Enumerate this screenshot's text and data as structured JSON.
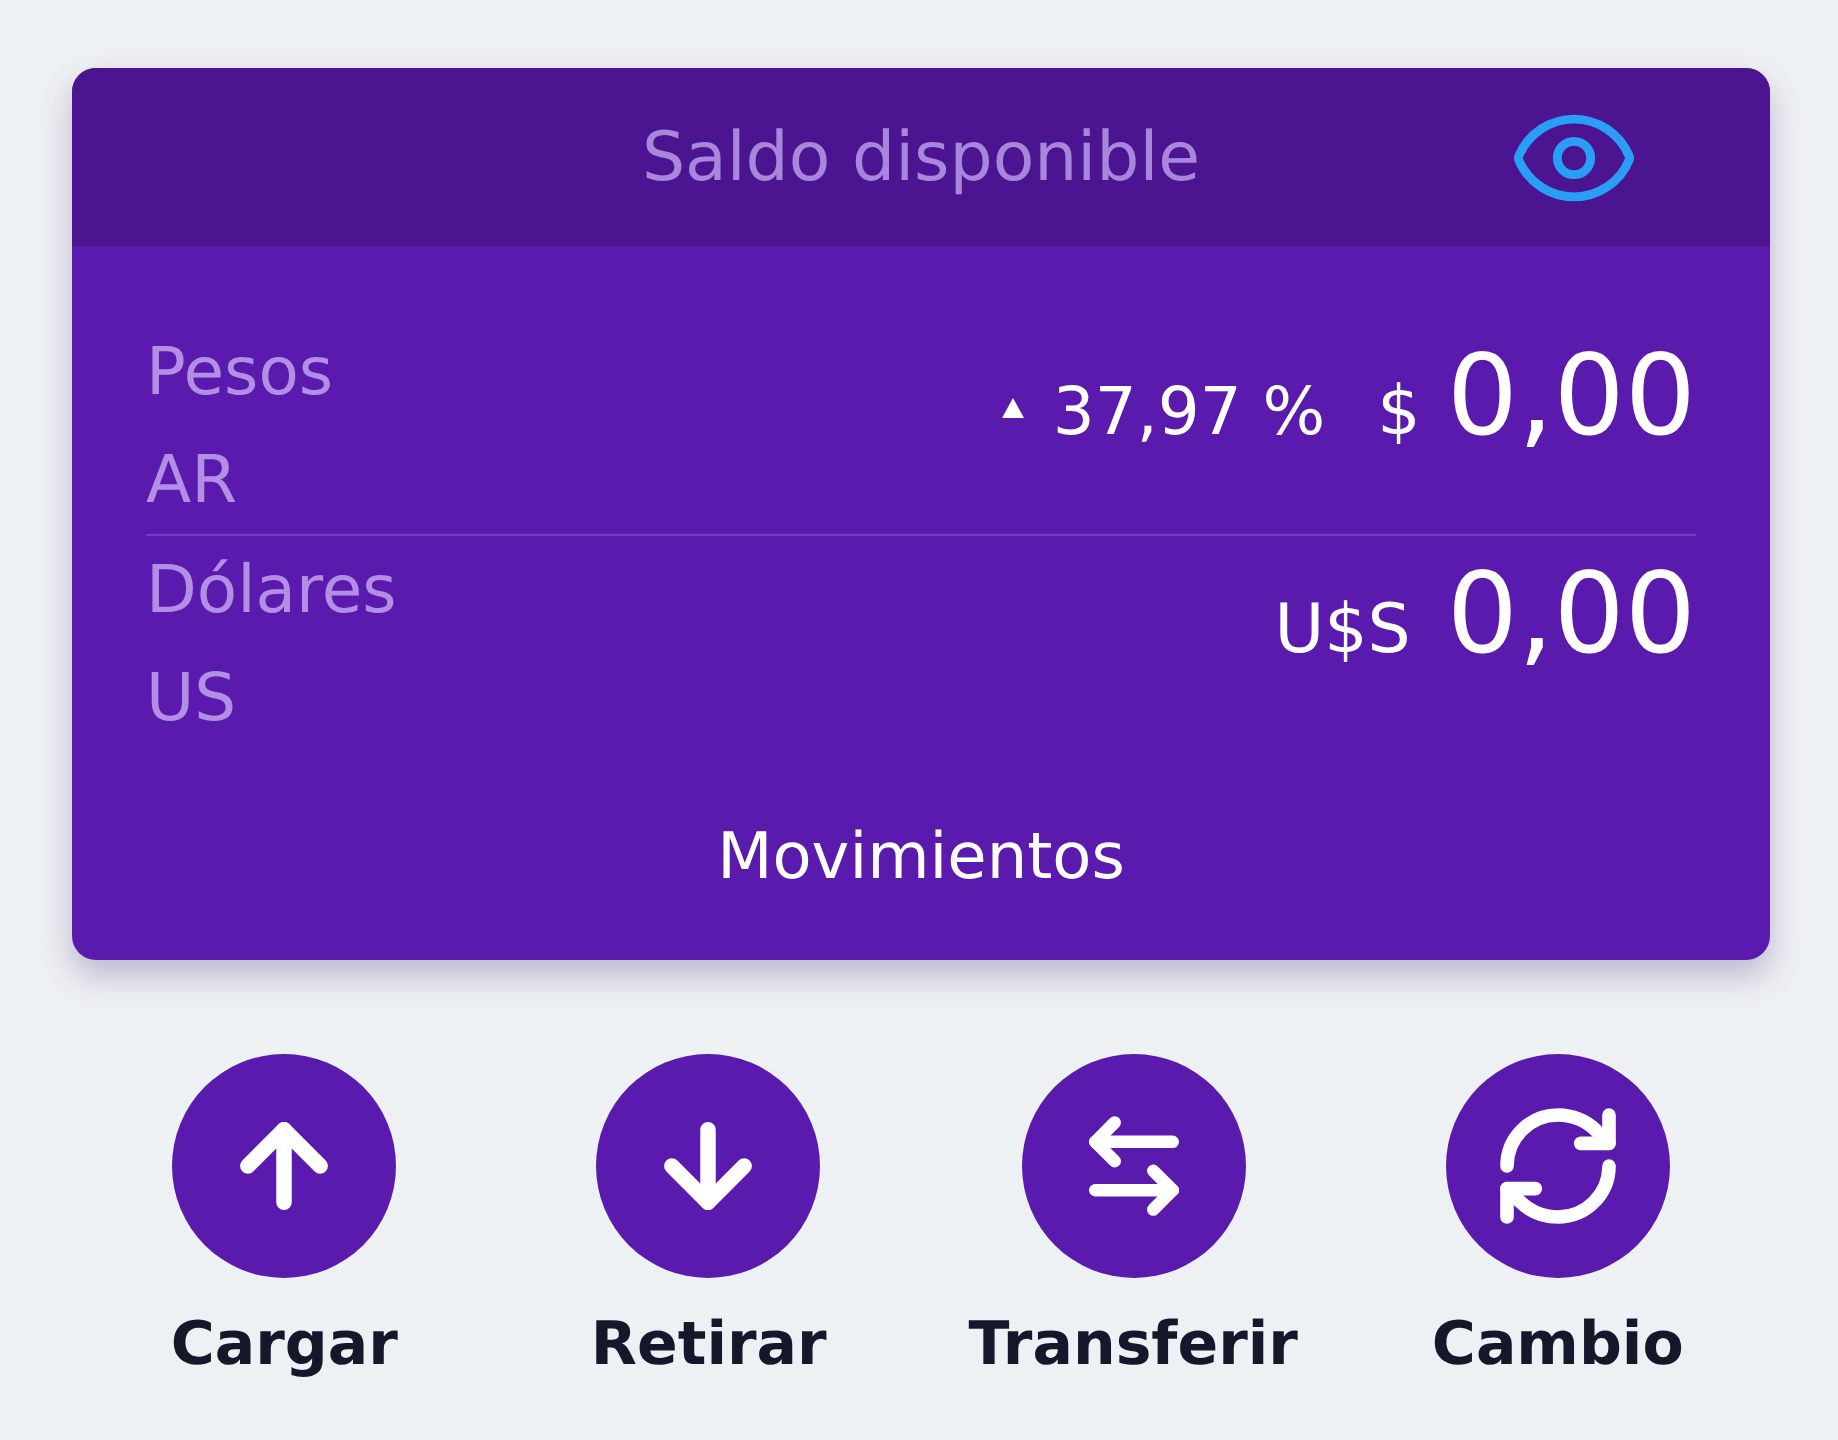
{
  "header": {
    "title": "Saldo disponible"
  },
  "balances": [
    {
      "label": "Pesos AR",
      "change": {
        "rising": true,
        "value": "37,97 %"
      },
      "symbol": "$",
      "amount": "0,00"
    },
    {
      "label": "Dólares US",
      "symbol": "U$S",
      "amount": "0,00"
    }
  ],
  "movements_link": "Movimientos",
  "actions": [
    {
      "kind": "upload",
      "label": "Cargar"
    },
    {
      "kind": "withdraw",
      "label": "Retirar"
    },
    {
      "kind": "transfer",
      "label": "Transferir"
    },
    {
      "kind": "exchange",
      "label": "Cambio"
    }
  ]
}
